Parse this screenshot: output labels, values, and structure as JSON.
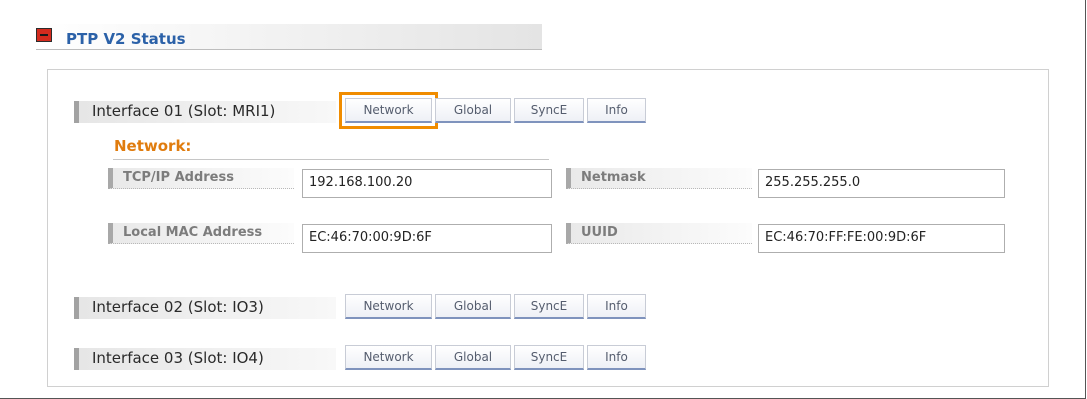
{
  "section": {
    "title": "PTP V2 Status"
  },
  "network_panel": {
    "title": "Network:",
    "fields": {
      "tcpip": {
        "label": "TCP/IP Address",
        "value": "192.168.100.20"
      },
      "netmask": {
        "label": "Netmask",
        "value": "255.255.255.0"
      },
      "mac": {
        "label": "Local MAC Address",
        "value": "EC:46:70:00:9D:6F"
      },
      "uuid": {
        "label": "UUID",
        "value": "EC:46:70:FF:FE:00:9D:6F"
      }
    }
  },
  "interfaces": [
    {
      "label": "Interface 01 (Slot: MRI1)",
      "tabs": [
        "Network",
        "Global",
        "SyncE",
        "Info"
      ],
      "active_tab": "Network"
    },
    {
      "label": "Interface 02 (Slot: IO3)",
      "tabs": [
        "Network",
        "Global",
        "SyncE",
        "Info"
      ]
    },
    {
      "label": "Interface 03 (Slot: IO4)",
      "tabs": [
        "Network",
        "Global",
        "SyncE",
        "Info"
      ]
    }
  ],
  "colors": {
    "title_blue": "#2b61a8",
    "network_orange": "#e07c0e",
    "active_highlight": "#f08c00",
    "collapse_red": "#d42b1e"
  }
}
